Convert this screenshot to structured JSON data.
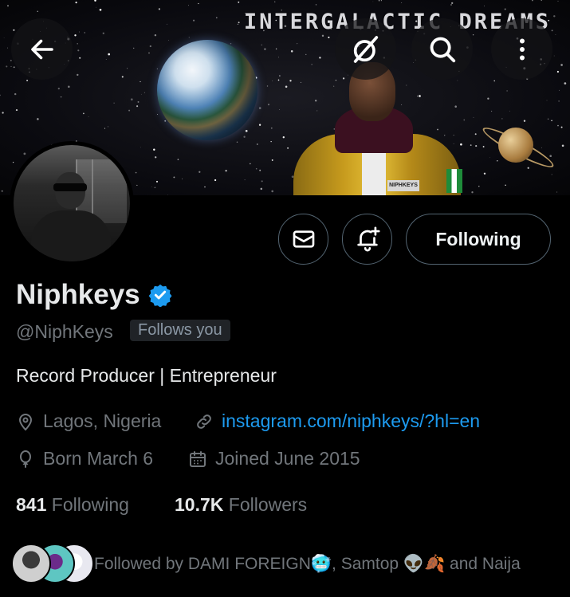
{
  "banner": {
    "title": "INTERGALACTIC DREAMS",
    "jacket_badge": "NIPHKEYS"
  },
  "top_bar": {
    "back_icon": "arrow-left-icon",
    "grok_icon": "grok-slash-icon",
    "search_icon": "search-icon",
    "more_icon": "more-vertical-icon"
  },
  "actions": {
    "message_icon": "envelope-icon",
    "notify_icon": "bell-plus-icon",
    "follow_label": "Following"
  },
  "profile": {
    "name": "Niphkeys",
    "verified_icon": "verified-badge-icon",
    "handle": "@NiphKeys",
    "follows_you": "Follows you",
    "bio": "Record Producer | Entrepreneur",
    "location": "Lagos, Nigeria",
    "website": "instagram.com/niphkeys/?hl=en",
    "birthday": "Born March 6",
    "joined": "Joined June 2015"
  },
  "stats": {
    "following_count": "841",
    "following_label": "Following",
    "followers_count": "10.7K",
    "followers_label": "Followers"
  },
  "followed_by": {
    "text": "Followed by DAMI FOREIGN🥶, Samtop 👽🍂 and Naija"
  },
  "colors": {
    "background": "#000000",
    "text_primary": "#e7e9ea",
    "text_secondary": "#71767b",
    "link": "#1d9bf0",
    "verified": "#1d9bf0",
    "border": "#536471"
  }
}
